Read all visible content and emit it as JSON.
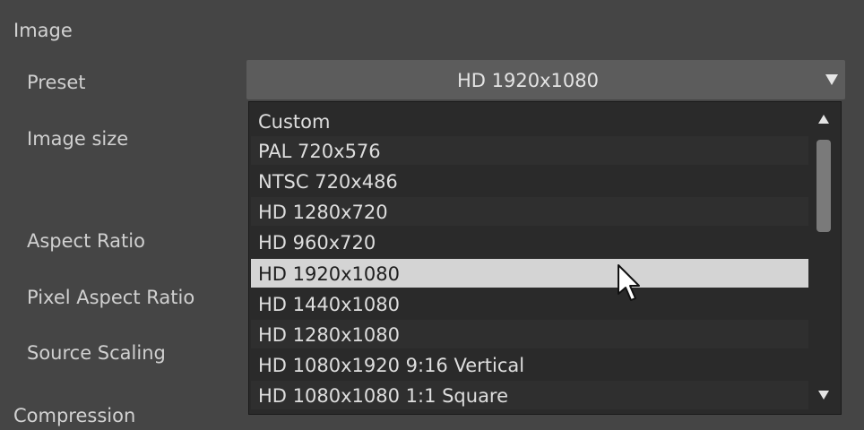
{
  "sections": {
    "image": "Image",
    "compression": "Compression"
  },
  "labels": {
    "preset": "Preset",
    "image_size": "Image size",
    "aspect_ratio": "Aspect Ratio",
    "pixel_aspect_ratio": "Pixel Aspect Ratio",
    "source_scaling": "Source Scaling"
  },
  "preset": {
    "selected": "HD 1920x1080",
    "options": [
      "Custom",
      "PAL 720x576",
      "NTSC 720x486",
      "HD 1280x720",
      "HD 960x720",
      "HD 1920x1080",
      "HD 1440x1080",
      "HD 1280x1080",
      "HD 1080x1920 9:16 Vertical",
      "HD 1080x1080 1:1 Square"
    ],
    "highlighted_index": 5
  },
  "icons": {
    "dropdown_arrow": "triangle-down-icon",
    "scroll_up": "triangle-up-icon",
    "scroll_down": "triangle-down-icon",
    "cursor": "mouse-pointer-icon"
  },
  "colors": {
    "background": "#454545",
    "dropdown": "#5c5c5c",
    "list_background": "#2a2a2a",
    "highlight": "#d4d4d4"
  }
}
